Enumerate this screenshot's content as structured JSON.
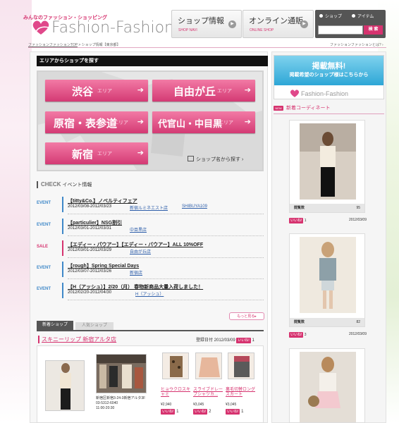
{
  "site": {
    "tagline": "みんなのファッション・ショッピング",
    "logo": "Fashion-Fashion",
    "logo_small": "Fashion-Fashion"
  },
  "nav": {
    "shop_info": {
      "title": "ショップ情報",
      "sub": "SHOP NAVI"
    },
    "online": {
      "title": "オンライン通販",
      "sub": "ONLINE SHOP"
    }
  },
  "search": {
    "radio_shop": "ショップ",
    "radio_item": "アイテム",
    "placeholder": "",
    "button": "検 索"
  },
  "breadcrumb": {
    "home": "ファッションファッションTOP",
    "rest": " > ショップ情報【東京都】"
  },
  "about_link": "ファッションファッションとは? ›",
  "area": {
    "heading": "エリアからショップを探す",
    "buttons": [
      {
        "name": "渋谷",
        "suffix": "エリア"
      },
      {
        "name": "自由が丘",
        "suffix": "エリア"
      },
      {
        "name": "原宿・表参道",
        "suffix": "エリア"
      },
      {
        "name": "代官山・中目黒",
        "suffix": "エリア"
      },
      {
        "name": "新宿",
        "suffix": "エリア"
      }
    ],
    "by_name": "ショップ名から探す ›"
  },
  "check": {
    "label": "CHECK",
    "title": "イベント情報"
  },
  "events": [
    {
      "type": "EVENT",
      "color": "#3f88c8",
      "title": "【titty&Co.】ノベルティフェア",
      "dates": "2012/03/08-2012/03/23",
      "link1": "新宿ルミネエスト店",
      "link2": "SHIBUYA109"
    },
    {
      "type": "EVENT",
      "color": "#3f88c8",
      "title": "【particulier】NSG割引",
      "dates": "2012/03/01-2012/03/31",
      "link1": "中目黒店",
      "link2": ""
    },
    {
      "type": "SALE",
      "color": "#d6336f",
      "title": "【エディー・パウアー】【エディー・バウアー】ALL 10%OFF",
      "dates": "2012/03/01-2012/03/29",
      "link1": "自由が丘店",
      "link2": ""
    },
    {
      "type": "EVENT",
      "color": "#3f88c8",
      "title": "【rough】Spring Special Days",
      "dates": "2012/03/07-2012/03/26",
      "link1": "新宿店",
      "link2": ""
    },
    {
      "type": "EVENT",
      "color": "#3f88c8",
      "title": "【H（アッシュ）】2/20（月） 春物新商品大量入荷しました！",
      "dates": "2012/02/20-2012/04/30",
      "link1": "H（アッシュ）",
      "link2": ""
    }
  ],
  "more": "もっと見る▸",
  "tabs": {
    "new": "新着ショップ",
    "popular": "人気ショップ"
  },
  "shop": {
    "name": "スキニーリップ 新宿アルタ店",
    "registered": "登録日付 2012/03/09",
    "likes": "1",
    "address": "新宿区新宿3-24-3新宿アルタ3F",
    "tel": "03-5312-6040",
    "hours": "11:00-20:30"
  },
  "iine": "いいね!",
  "items": [
    {
      "name": "ヒョウクロスキャミ",
      "price": "¥2,940",
      "likes": "1"
    },
    {
      "name": "スライブドレープシャツカ...",
      "price": "¥3,045",
      "likes": "2"
    },
    {
      "name": "裏毛切替ロングスカート",
      "price": "¥3,045",
      "likes": "1"
    }
  ],
  "banner": {
    "line1": "掲載無料!",
    "line2": "掲載希望のショップ様はこちらから"
  },
  "coord": {
    "icon": "NEW",
    "heading": "新着コーディネート"
  },
  "views_label": "閲覧数",
  "coords": [
    {
      "views": "95",
      "likes": "1",
      "date": "2012/03/09"
    },
    {
      "views": "82",
      "likes": "3",
      "date": "2012/03/09"
    }
  ]
}
